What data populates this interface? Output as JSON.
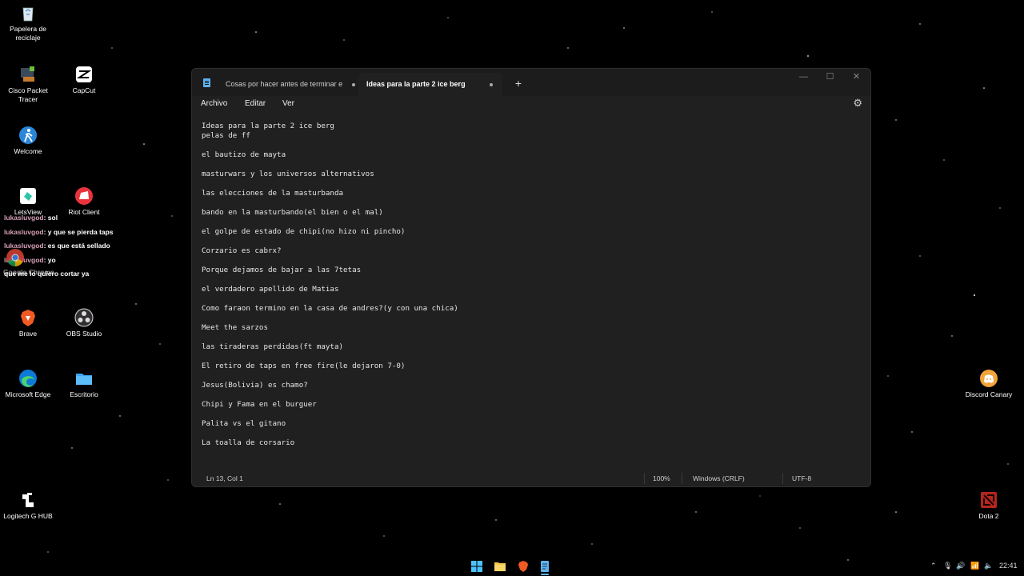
{
  "desktop": {
    "icons_left": [
      {
        "label": "Papelera de reciclaje",
        "icon": "recycle-bin-icon"
      },
      {
        "label": "Cisco Packet Tracer",
        "icon": "cisco-icon"
      },
      {
        "label": "CapCut",
        "icon": "capcut-icon"
      },
      {
        "label": "Welcome",
        "icon": "welcome-icon"
      },
      {
        "label": "LetsView",
        "icon": "letsview-icon"
      },
      {
        "label": "Riot Client",
        "icon": "riot-icon"
      },
      {
        "label": "Google Chrome",
        "icon": "chrome-icon"
      },
      {
        "label": "Brave",
        "icon": "brave-icon"
      },
      {
        "label": "OBS Studio",
        "icon": "obs-icon"
      },
      {
        "label": "Microsoft Edge",
        "icon": "edge-icon"
      },
      {
        "label": "Escritorio",
        "icon": "folder-icon"
      },
      {
        "label": "Logitech G HUB",
        "icon": "logitech-icon"
      }
    ],
    "icons_right": [
      {
        "label": "Discord Canary",
        "icon": "discord-icon"
      },
      {
        "label": "Dota 2",
        "icon": "dota-icon"
      }
    ]
  },
  "chat": [
    {
      "user": "lukasluvgod",
      "message": ": sol"
    },
    {
      "user": "lukasluvgod",
      "message": ": y que se pierda taps"
    },
    {
      "user": "lukasluvgod",
      "message": ": es que está sellado"
    },
    {
      "user": "lukasluvgod",
      "message": ": yo"
    },
    {
      "user": "",
      "message": "que me lo quiero cortar ya"
    }
  ],
  "notepad": {
    "tabs": [
      {
        "label": "Cosas por hacer antes de terminar e",
        "active": false
      },
      {
        "label": "Ideas para la parte 2 ice berg",
        "active": true
      }
    ],
    "new_tab": "+",
    "controls": {
      "minimize": "—",
      "maximize": "☐",
      "close": "✕"
    },
    "menu": [
      "Archivo",
      "Editar",
      "Ver"
    ],
    "lines": [
      "Ideas para la parte 2 ice berg",
      "pelas de ff",
      "",
      "el bautizo de mayta",
      "",
      "masturwars y los universos alternativos",
      "",
      "las elecciones de la masturbanda",
      "",
      "bando en la masturbando(el bien o el mal)",
      "",
      "el golpe de estado de chipi(no hizo ni pincho)",
      "",
      "Corzario es cabrx?",
      "",
      "Porque dejamos de bajar a las 7tetas",
      "",
      "el verdadero apellido de Matias",
      "",
      "Como faraon termino en la casa de andres?(y con una chica)",
      "",
      "Meet the sarzos",
      "",
      "las tiraderas perdidas(ft mayta)",
      "",
      "El retiro de taps en free fire(le dejaron 7-0)",
      "",
      "Jesus(Bolivia) es chamo?",
      "",
      "Chipi y Fama en el burguer",
      "",
      "Palita vs el gitano",
      "",
      "La toalla de corsario"
    ],
    "status": {
      "position": "Ln 13, Col 1",
      "zoom": "100%",
      "line_ending": "Windows (CRLF)",
      "encoding": "UTF-8"
    }
  },
  "taskbar": {
    "clock": "22:41"
  }
}
